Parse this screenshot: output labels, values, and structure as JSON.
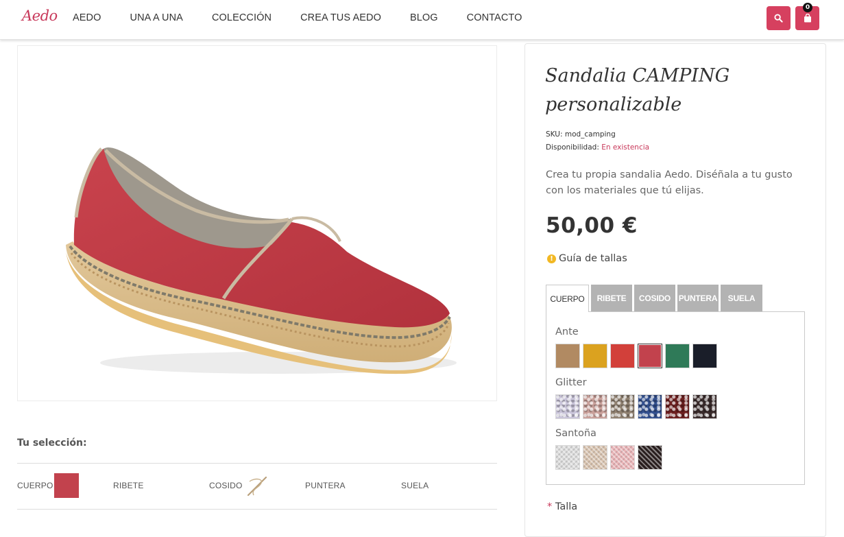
{
  "header": {
    "logo": "Aedo",
    "nav": [
      "AEDO",
      "UNA A UNA",
      "COLECCIÓN",
      "CREA TUS AEDO",
      "BLOG",
      "CONTACTO"
    ],
    "cart_count": "0",
    "accent_color": "#d6405f"
  },
  "product": {
    "title_line1": "Sandalia CAMPING",
    "title_line2": "personalizable",
    "sku_label": "SKU:",
    "sku": "mod_camping",
    "availability_label": "Disponibilidad:",
    "availability": "En existencia",
    "description": "Crea tu propia sandalia Aedo. Diséñala a tu gusto con los materiales que tú elijas.",
    "price": "50,00 €",
    "size_guide": "Guía de tallas",
    "size_label": "Talla",
    "required_mark": "*"
  },
  "customizer": {
    "tabs": [
      "CUERPO",
      "RIBETE",
      "COSIDO",
      "PUNTERA",
      "SUELA"
    ],
    "active_tab": "CUERPO",
    "groups": [
      {
        "label": "Ante",
        "swatches": [
          "#b18a62",
          "#dba21f",
          "#d2403a",
          "#c2424d",
          "#2f7a58",
          "#1a1e29"
        ],
        "selected_index": 3
      },
      {
        "label": "Glitter",
        "swatches": [
          "#c9c4d9",
          "#c9a09a",
          "#8f8070",
          "#33508f",
          "#6d1f1f",
          "#3a2b2b"
        ]
      },
      {
        "label": "Santoña",
        "swatches": [
          "#dcdcdc",
          "#d9c4b0",
          "#eab5b8",
          "#2a1f1f"
        ]
      }
    ]
  },
  "selection": {
    "title": "Tu selección:",
    "items": [
      "CUERPO",
      "RIBETE",
      "COSIDO",
      "PUNTERA",
      "SUELA"
    ],
    "cuerpo_color": "#c2424d"
  }
}
